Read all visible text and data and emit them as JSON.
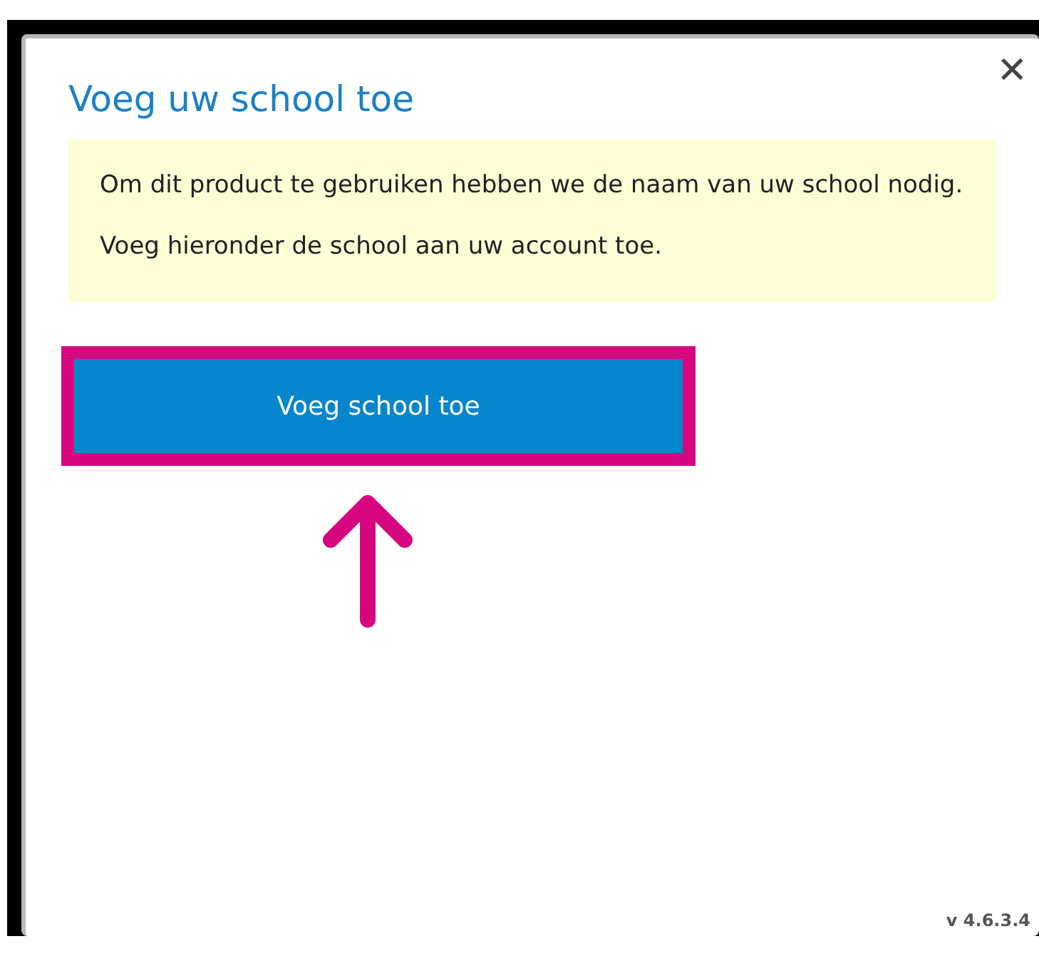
{
  "dialog": {
    "title": "Voeg uw school toe",
    "close_symbol": "✕",
    "notice": [
      "Om dit product te gebruiken hebben we de naam van uw school nodig.",
      "Voeg hieronder de school aan uw account toe."
    ],
    "button": {
      "label": "Voeg school toe",
      "highlighted": true,
      "pointer_arrow": true
    },
    "version": "v 4.6.3.4"
  }
}
